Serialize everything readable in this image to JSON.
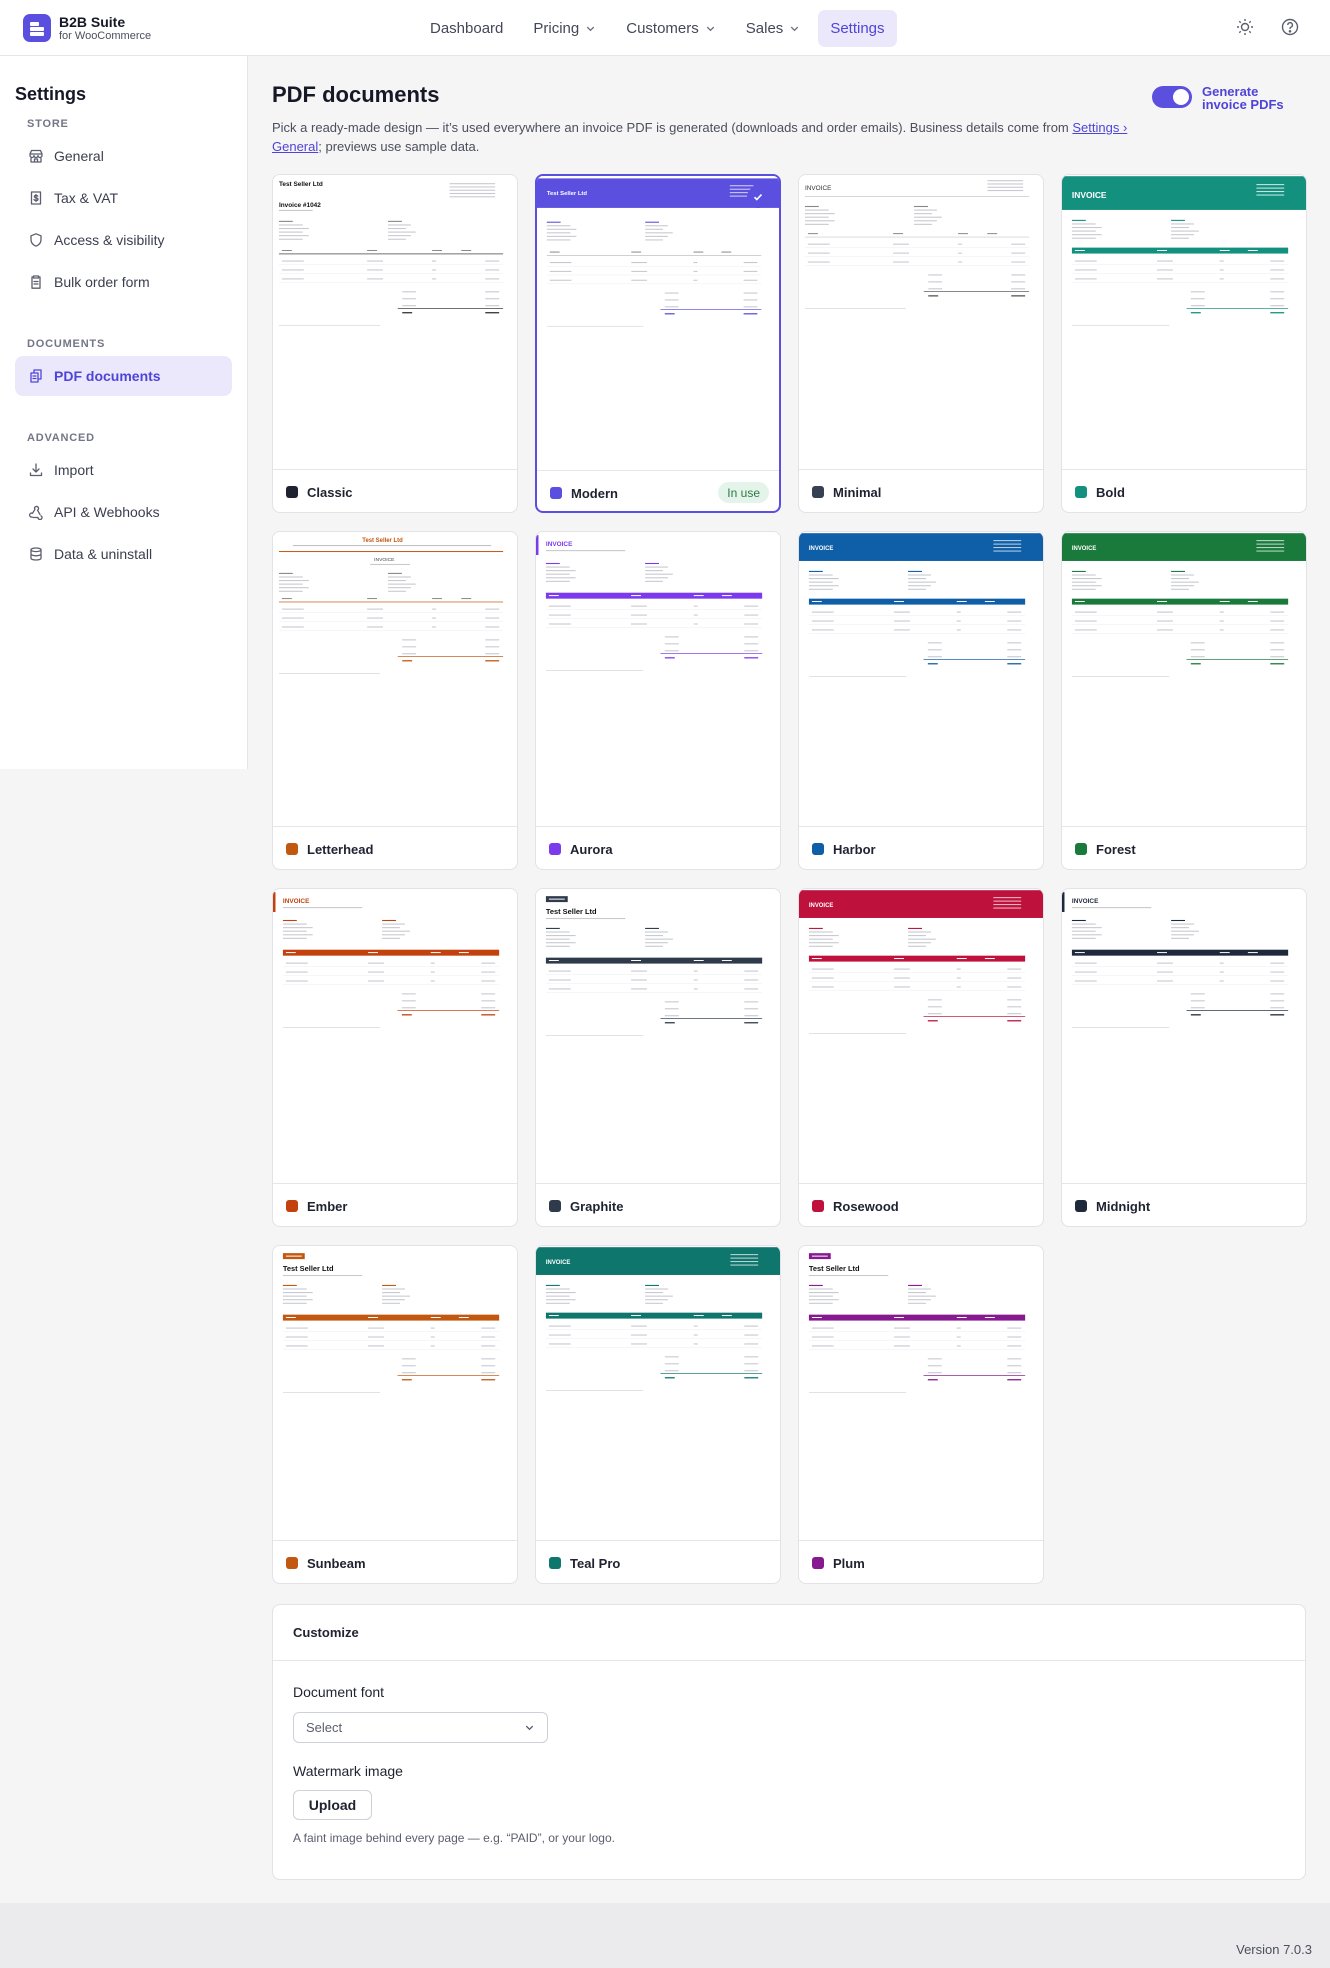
{
  "brand": {
    "name": "B2B Suite",
    "sub": "for WooCommerce"
  },
  "nav": [
    {
      "label": "Dashboard",
      "has_menu": false,
      "active": false
    },
    {
      "label": "Pricing",
      "has_menu": true,
      "active": false
    },
    {
      "label": "Customers",
      "has_menu": true,
      "active": false
    },
    {
      "label": "Sales",
      "has_menu": true,
      "active": false
    },
    {
      "label": "Settings",
      "has_menu": false,
      "active": true
    }
  ],
  "top_icons": [
    "sun-icon",
    "help-icon"
  ],
  "sidebar": {
    "title": "Settings",
    "sections": [
      {
        "heading": "STORE",
        "items": [
          {
            "label": "General",
            "icon": "store-icon"
          },
          {
            "label": "Tax & VAT",
            "icon": "receipt-icon"
          },
          {
            "label": "Access & visibility",
            "icon": "shield-icon"
          },
          {
            "label": "Bulk order form",
            "icon": "clipboard-icon"
          }
        ]
      },
      {
        "heading": "DOCUMENTS",
        "items": [
          {
            "label": "PDF documents",
            "icon": "documents-icon",
            "active": true
          }
        ]
      },
      {
        "heading": "ADVANCED",
        "items": [
          {
            "label": "Import",
            "icon": "download-icon"
          },
          {
            "label": "API & Webhooks",
            "icon": "webhook-icon"
          },
          {
            "label": "Data & uninstall",
            "icon": "database-icon"
          }
        ]
      }
    ]
  },
  "page": {
    "title": "PDF documents",
    "desc_before": "Pick a ready-made design — it’s used everywhere an invoice PDF is generated (downloads and order emails). Business details come from ",
    "desc_link": "Settings › General",
    "desc_after": "; previews use sample data.",
    "toggle_label": "Generate invoice PDFs",
    "toggle_on": true
  },
  "templates": [
    {
      "name": "Classic",
      "color": "#1f2230",
      "style": "classic"
    },
    {
      "name": "Modern",
      "color": "#5b4fe0",
      "style": "modern",
      "selected": true,
      "badge": "In use"
    },
    {
      "name": "Minimal",
      "color": "#374151",
      "style": "minimal"
    },
    {
      "name": "Bold",
      "color": "#14917e",
      "style": "bold"
    },
    {
      "name": "Letterhead",
      "color": "#c2570f",
      "style": "letterhead"
    },
    {
      "name": "Aurora",
      "color": "#7c3aed",
      "style": "aurora"
    },
    {
      "name": "Harbor",
      "color": "#0f5ea8",
      "style": "banner"
    },
    {
      "name": "Forest",
      "color": "#1a7a3c",
      "style": "banner"
    },
    {
      "name": "Ember",
      "color": "#c2410c",
      "style": "ember"
    },
    {
      "name": "Graphite",
      "color": "#2f3a4b",
      "style": "tag"
    },
    {
      "name": "Rosewood",
      "color": "#be123c",
      "style": "banner"
    },
    {
      "name": "Midnight",
      "color": "#1e293b",
      "style": "ember"
    },
    {
      "name": "Sunbeam",
      "color": "#c2570f",
      "style": "tag"
    },
    {
      "name": "Teal Pro",
      "color": "#0f766e",
      "style": "banner"
    },
    {
      "name": "Plum",
      "color": "#86198f",
      "style": "tag"
    }
  ],
  "sample": {
    "seller": "Test Seller Ltd",
    "invoice": "INVOICE",
    "invoice_no": "Invoice #1042"
  },
  "customize": {
    "heading": "Customize",
    "font_label": "Document font",
    "font_placeholder": "Select",
    "watermark_label": "Watermark image",
    "upload_label": "Upload",
    "hint": "A faint image behind every page — e.g. “PAID”, or your logo."
  },
  "footer": {
    "version": "Version 7.0.3"
  }
}
